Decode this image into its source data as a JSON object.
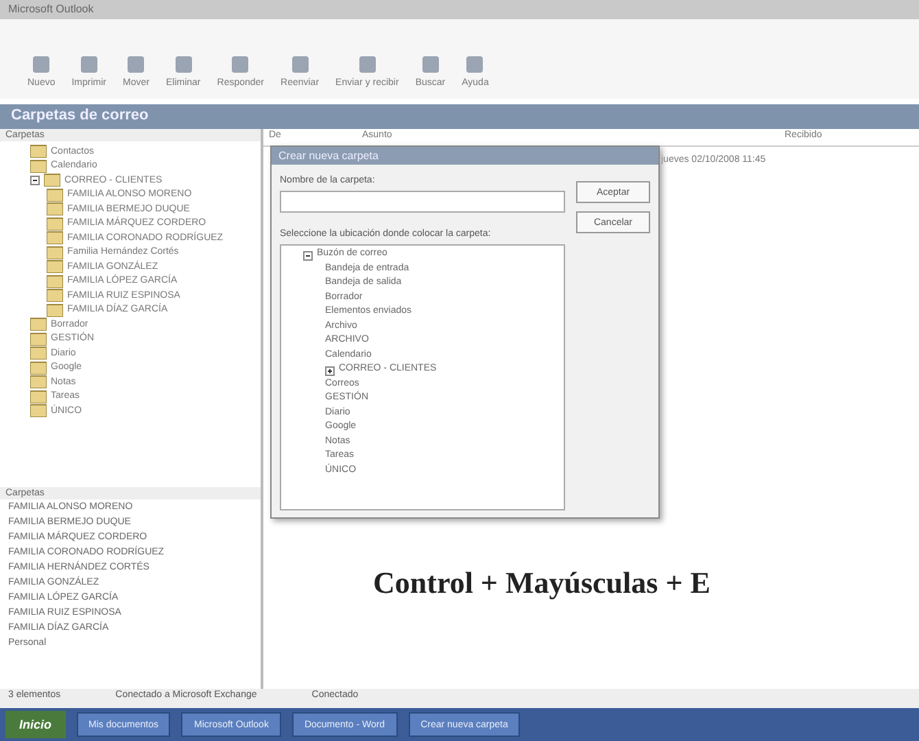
{
  "window": {
    "title": "Microsoft Outlook"
  },
  "toolbar": [
    {
      "label": "Nuevo"
    },
    {
      "label": "Imprimir"
    },
    {
      "label": "Mover"
    },
    {
      "label": "Eliminar"
    },
    {
      "label": "Responder"
    },
    {
      "label": "Reenviar"
    },
    {
      "label": "Enviar y recibir"
    },
    {
      "label": "Buscar"
    },
    {
      "label": "Ayuda"
    }
  ],
  "header": {
    "title": "Carpetas de correo"
  },
  "sidebar": {
    "title": "Carpetas",
    "items": [
      {
        "label": "Contactos"
      },
      {
        "label": "Calendario"
      },
      {
        "label": "CORREO - CLIENTES",
        "expanded": true,
        "children": [
          {
            "label": "FAMILIA ALONSO MORENO"
          },
          {
            "label": "FAMILIA BERMEJO DUQUE"
          },
          {
            "label": "FAMILIA MÁRQUEZ CORDERO"
          },
          {
            "label": "FAMILIA CORONADO RODRÍGUEZ"
          },
          {
            "label": "Familia Hernández Cortés"
          },
          {
            "label": "FAMILIA GONZÁLEZ"
          },
          {
            "label": "FAMILIA LÓPEZ GARCÍA"
          },
          {
            "label": "FAMILIA RUIZ ESPINOSA"
          },
          {
            "label": "FAMILIA DÍAZ GARCÍA"
          }
        ]
      },
      {
        "label": "Borrador"
      },
      {
        "label": "GESTIÓN"
      },
      {
        "label": "Diario"
      },
      {
        "label": "Google"
      },
      {
        "label": "Notas"
      },
      {
        "label": "Tareas"
      },
      {
        "label": "ÚNICO"
      }
    ]
  },
  "lower_list": {
    "title": "Carpetas",
    "items": [
      "FAMILIA ALONSO MORENO",
      "FAMILIA BERMEJO DUQUE",
      "FAMILIA MÁRQUEZ CORDERO",
      "FAMILIA CORONADO RODRÍGUEZ",
      "FAMILIA HERNÁNDEZ CORTÉS",
      "FAMILIA GONZÁLEZ",
      "FAMILIA LÓPEZ GARCÍA",
      "FAMILIA RUIZ ESPINOSA",
      "FAMILIA DÍAZ GARCÍA",
      "Personal"
    ]
  },
  "table": {
    "columns": [
      "De",
      "Asunto",
      "Recibido"
    ],
    "rows": [
      {
        "text": "jueves 02/10/2008 11:45"
      }
    ]
  },
  "dialog": {
    "title": "Crear nueva carpeta",
    "name_label": "Nombre de la carpeta:",
    "location_label": "Seleccione la ubicación donde colocar la carpeta:",
    "buttons": [
      "Aceptar",
      "Cancelar"
    ],
    "tree": [
      {
        "label": "Buzón de correo",
        "expanded": true,
        "children": [
          {
            "label": "Bandeja de entrada"
          },
          {
            "label": "Bandeja de salida"
          },
          {
            "label": "Borrador"
          },
          {
            "label": "Elementos enviados"
          },
          {
            "label": "Archivo"
          },
          {
            "label": "ARCHIVO"
          },
          {
            "label": "Calendario"
          },
          {
            "label": "CORREO - CLIENTES",
            "expanded": false
          },
          {
            "label": "Correos"
          },
          {
            "label": "GESTIÓN"
          },
          {
            "label": "Diario"
          },
          {
            "label": "Google"
          },
          {
            "label": "Notas"
          },
          {
            "label": "Tareas"
          },
          {
            "label": "ÚNICO"
          }
        ]
      }
    ]
  },
  "caption": "Control + Mayúsculas + E",
  "status_bar": {
    "left": "3 elementos",
    "middle": "Conectado a Microsoft Exchange",
    "right": "Conectado"
  },
  "taskbar": {
    "start": "Inicio",
    "tasks": [
      "Mis documentos",
      "Microsoft Outlook",
      "Documento - Word",
      "Crear nueva carpeta"
    ]
  }
}
